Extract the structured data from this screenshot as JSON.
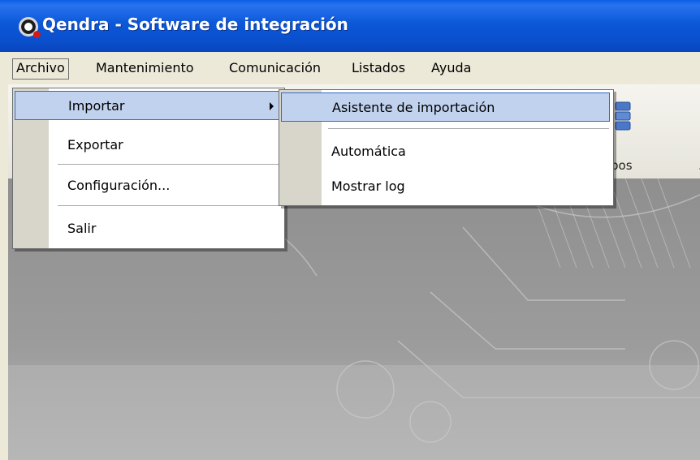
{
  "window": {
    "title": "Qendra - Software de integración"
  },
  "menubar": {
    "items": [
      "Archivo",
      "Mantenimiento",
      "Comunicación",
      "Listados",
      "Ayuda"
    ]
  },
  "archivo_menu": {
    "importar": "Importar",
    "exportar": "Exportar",
    "configuracion": "Configuración...",
    "salir": "Salir"
  },
  "importar_submenu": {
    "asistente": "Asistente de importación",
    "automatica": "Automática",
    "mostrar_log": "Mostrar log"
  },
  "toolbar": {
    "label_partial": "pos",
    "label_partial_2": "."
  },
  "colors": {
    "titlebar": "#0a58d8",
    "highlight": "#c1d2ee",
    "highlight_border": "#316ac5",
    "menu_gutter": "#d8d6cb"
  }
}
